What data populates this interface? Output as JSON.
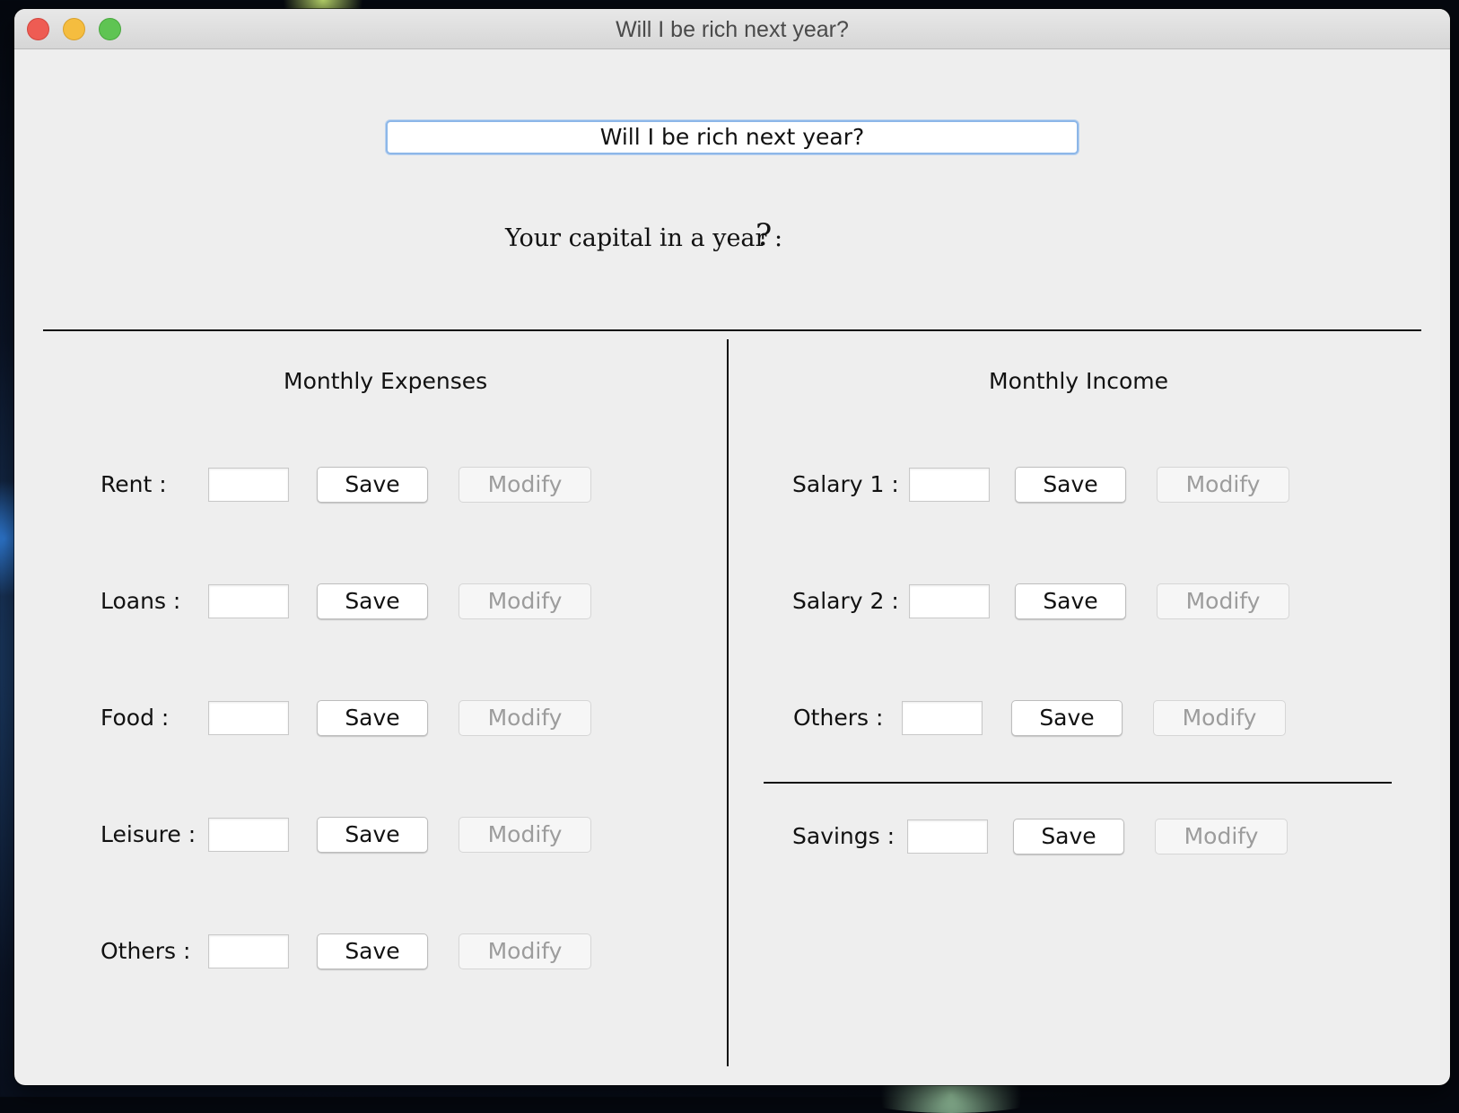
{
  "window": {
    "title": "Will I be rich next year?"
  },
  "header": {
    "title_field_value": "Will I be rich next year?",
    "capital_label": "Your capital in a year :",
    "capital_value": "?"
  },
  "expenses": {
    "title": "Monthly Expenses",
    "rows": [
      {
        "label": "Rent :",
        "value": "",
        "save_label": "Save",
        "modify_label": "Modify"
      },
      {
        "label": "Loans :",
        "value": "",
        "save_label": "Save",
        "modify_label": "Modify"
      },
      {
        "label": "Food :",
        "value": "",
        "save_label": "Save",
        "modify_label": "Modify"
      },
      {
        "label": "Leisure :",
        "value": "",
        "save_label": "Save",
        "modify_label": "Modify"
      },
      {
        "label": "Others :",
        "value": "",
        "save_label": "Save",
        "modify_label": "Modify"
      }
    ]
  },
  "income": {
    "title": "Monthly Income",
    "rows": [
      {
        "label": "Salary 1 :",
        "value": "",
        "save_label": "Save",
        "modify_label": "Modify"
      },
      {
        "label": "Salary 2 :",
        "value": "",
        "save_label": "Save",
        "modify_label": "Modify"
      },
      {
        "label": "Others :",
        "value": "",
        "save_label": "Save",
        "modify_label": "Modify"
      }
    ],
    "savings": {
      "label": "Savings :",
      "value": "",
      "save_label": "Save",
      "modify_label": "Modify"
    }
  },
  "colors": {
    "window_bg": "#eeeeee",
    "focus_ring": "#8db7e8",
    "disabled_text": "#9c9c9c",
    "close": "#ee5c53",
    "minimize": "#f5bd3f",
    "maximize": "#5fc453"
  }
}
